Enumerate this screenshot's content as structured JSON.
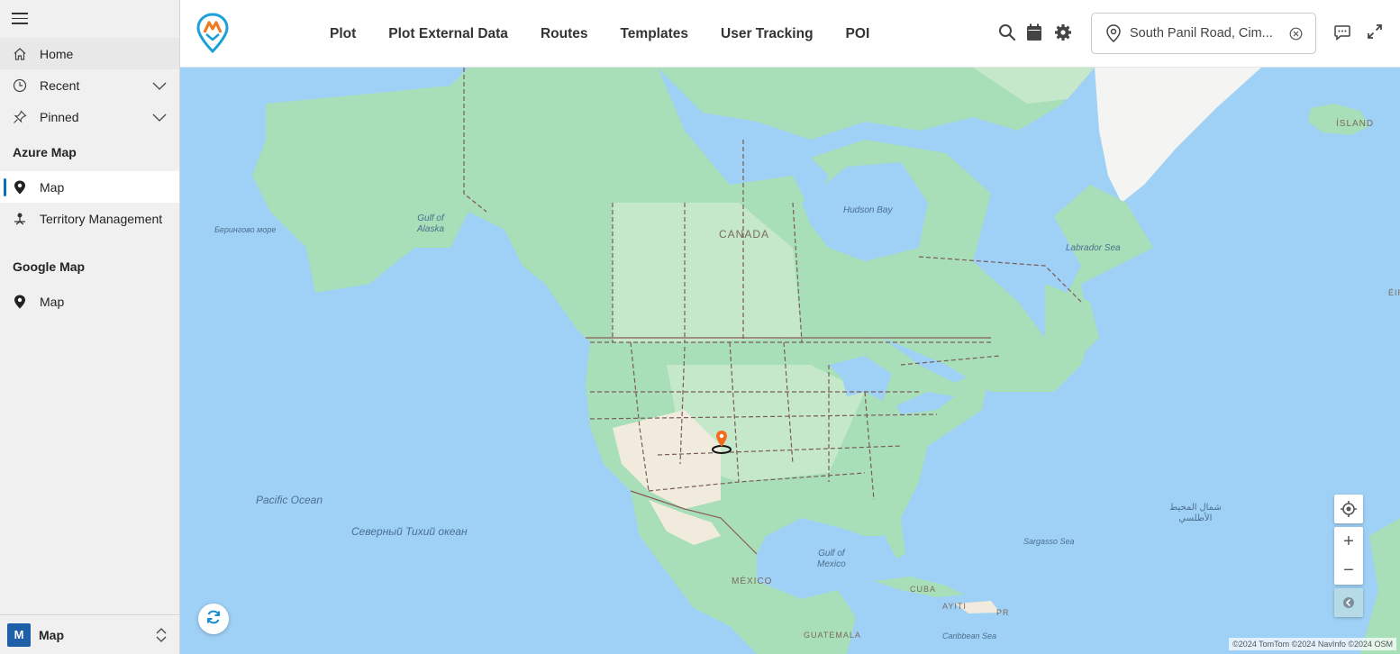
{
  "sidebar": {
    "menu_icon": "hamburger-icon",
    "home": {
      "label": "Home",
      "icon": "home-icon"
    },
    "recent": {
      "label": "Recent",
      "icon": "clock-icon"
    },
    "pinned": {
      "label": "Pinned",
      "icon": "pin-icon"
    },
    "groups": [
      {
        "title": "Azure Map",
        "items": [
          {
            "label": "Map",
            "icon": "map-marker-icon",
            "selected": true
          },
          {
            "label": "Territory Management",
            "icon": "territory-icon",
            "selected": false
          }
        ]
      },
      {
        "title": "Google Map",
        "items": [
          {
            "label": "Map",
            "icon": "map-marker-icon",
            "selected": false
          }
        ]
      }
    ],
    "area": {
      "badge": "M",
      "label": "Map"
    }
  },
  "topbar": {
    "tabs": [
      "Plot",
      "Plot External Data",
      "Routes",
      "Templates",
      "User Tracking",
      "POI"
    ],
    "location": {
      "value": "South Panil Road, Cim..."
    },
    "icons": [
      "search-icon",
      "calendar-icon",
      "settings-icon",
      "location-pin-icon",
      "clear-icon",
      "chat-icon",
      "expand-icon"
    ]
  },
  "map": {
    "labels": {
      "canada": "CANADA",
      "mexico": "MÉXICO",
      "cuba": "CUBA",
      "ayiti": "AYITI",
      "pr": "PR",
      "guatemala": "GUATEMALA",
      "island": "ÍSLAND",
      "eire": "ÉIR",
      "hudson_bay": "Hudson Bay",
      "labrador_sea": "Labrador Sea",
      "gulf_alaska_1": "Gulf of",
      "gulf_alaska_2": "Alaska",
      "bering": "Берингово море",
      "pacific": "Pacific Ocean",
      "north_pacific_ru": "Северный Тихий океан",
      "gulf_mexico_1": "Gulf of",
      "gulf_mexico_2": "Mexico",
      "sargasso": "Sargasso Sea",
      "caribbean": "Caribbean Sea",
      "atlantic_ar_1": "شمال المحيط",
      "atlantic_ar_2": "الأطلسي"
    },
    "controls": {
      "locate_icon": "crosshair-icon",
      "zoom_in": "+",
      "zoom_out": "−",
      "style_icon": "map-style-icon",
      "refresh_icon": "refresh-icon"
    },
    "attribution": "©2024 TomTom  ©2024 NavInfo  ©2024 OSM",
    "colors": {
      "water": "#9fd0f5",
      "land": "#a8dfb8",
      "highlight_land": "#c4e8c9",
      "desert": "#f1ebdd",
      "marker": "#f26b1d"
    }
  }
}
